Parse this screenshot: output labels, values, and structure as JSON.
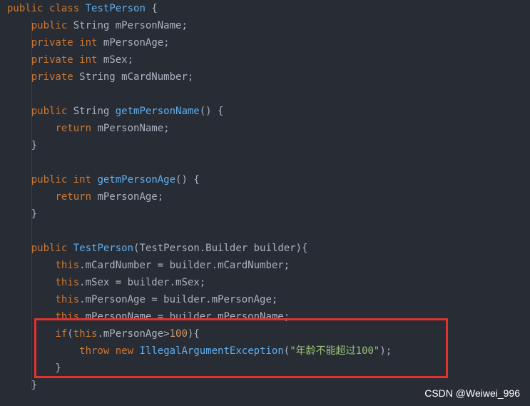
{
  "code": {
    "lines": [
      [
        {
          "t": "public",
          "c": "kw"
        },
        {
          "t": " "
        },
        {
          "t": "class",
          "c": "kw"
        },
        {
          "t": " "
        },
        {
          "t": "TestPerson",
          "c": "cls"
        },
        {
          "t": " {"
        }
      ],
      [
        {
          "t": "    "
        },
        {
          "t": "public",
          "c": "kw"
        },
        {
          "t": " String mPersonName;"
        }
      ],
      [
        {
          "t": "    "
        },
        {
          "t": "private",
          "c": "kw"
        },
        {
          "t": " "
        },
        {
          "t": "int",
          "c": "kw"
        },
        {
          "t": " mPersonAge;"
        }
      ],
      [
        {
          "t": "    "
        },
        {
          "t": "private",
          "c": "kw"
        },
        {
          "t": " "
        },
        {
          "t": "int",
          "c": "kw"
        },
        {
          "t": " mSex;"
        }
      ],
      [
        {
          "t": "    "
        },
        {
          "t": "private",
          "c": "kw"
        },
        {
          "t": " String mCardNumber;"
        }
      ],
      [],
      [
        {
          "t": "    "
        },
        {
          "t": "public",
          "c": "kw"
        },
        {
          "t": " String "
        },
        {
          "t": "getmPersonName",
          "c": "cls"
        },
        {
          "t": "() {"
        }
      ],
      [
        {
          "t": "        "
        },
        {
          "t": "return",
          "c": "kw"
        },
        {
          "t": " mPersonName;"
        }
      ],
      [
        {
          "t": "    }"
        }
      ],
      [],
      [
        {
          "t": "    "
        },
        {
          "t": "public",
          "c": "kw"
        },
        {
          "t": " "
        },
        {
          "t": "int",
          "c": "kw"
        },
        {
          "t": " "
        },
        {
          "t": "getmPersonAge",
          "c": "cls"
        },
        {
          "t": "() {"
        }
      ],
      [
        {
          "t": "        "
        },
        {
          "t": "return",
          "c": "kw"
        },
        {
          "t": " mPersonAge;"
        }
      ],
      [
        {
          "t": "    }"
        }
      ],
      [],
      [
        {
          "t": "    "
        },
        {
          "t": "public",
          "c": "kw"
        },
        {
          "t": " "
        },
        {
          "t": "TestPerson",
          "c": "cls"
        },
        {
          "t": "(TestPerson.Builder builder){"
        }
      ],
      [
        {
          "t": "        "
        },
        {
          "t": "this",
          "c": "kw"
        },
        {
          "t": ".mCardNumber = builder.mCardNumber;"
        }
      ],
      [
        {
          "t": "        "
        },
        {
          "t": "this",
          "c": "kw"
        },
        {
          "t": ".mSex = builder.mSex;"
        }
      ],
      [
        {
          "t": "        "
        },
        {
          "t": "this",
          "c": "kw"
        },
        {
          "t": ".mPersonAge = builder.mPersonAge;"
        }
      ],
      [
        {
          "t": "        "
        },
        {
          "t": "this",
          "c": "kw"
        },
        {
          "t": ".mPersonName = builder.mPersonName;"
        }
      ],
      [
        {
          "t": "        "
        },
        {
          "t": "if",
          "c": "kw"
        },
        {
          "t": "("
        },
        {
          "t": "this",
          "c": "kw"
        },
        {
          "t": ".mPersonAge>"
        },
        {
          "t": "100",
          "c": "num"
        },
        {
          "t": "){"
        }
      ],
      [
        {
          "t": "            "
        },
        {
          "t": "throw",
          "c": "kw"
        },
        {
          "t": " "
        },
        {
          "t": "new",
          "c": "kw"
        },
        {
          "t": " "
        },
        {
          "t": "IllegalArgumentException",
          "c": "cls"
        },
        {
          "t": "("
        },
        {
          "t": "\"年龄不能超过100\"",
          "c": "str"
        },
        {
          "t": ");"
        }
      ],
      [
        {
          "t": "        }"
        }
      ],
      [
        {
          "t": "    }"
        }
      ]
    ]
  },
  "watermark": "CSDN @Weiwei_996",
  "colors": {
    "background": "#282c34",
    "keyword": "#cc7832",
    "identifier": "#61afef",
    "string": "#98c379",
    "number": "#d19a66",
    "plain": "#abb2bf",
    "highlight_border": "#e0332f"
  }
}
